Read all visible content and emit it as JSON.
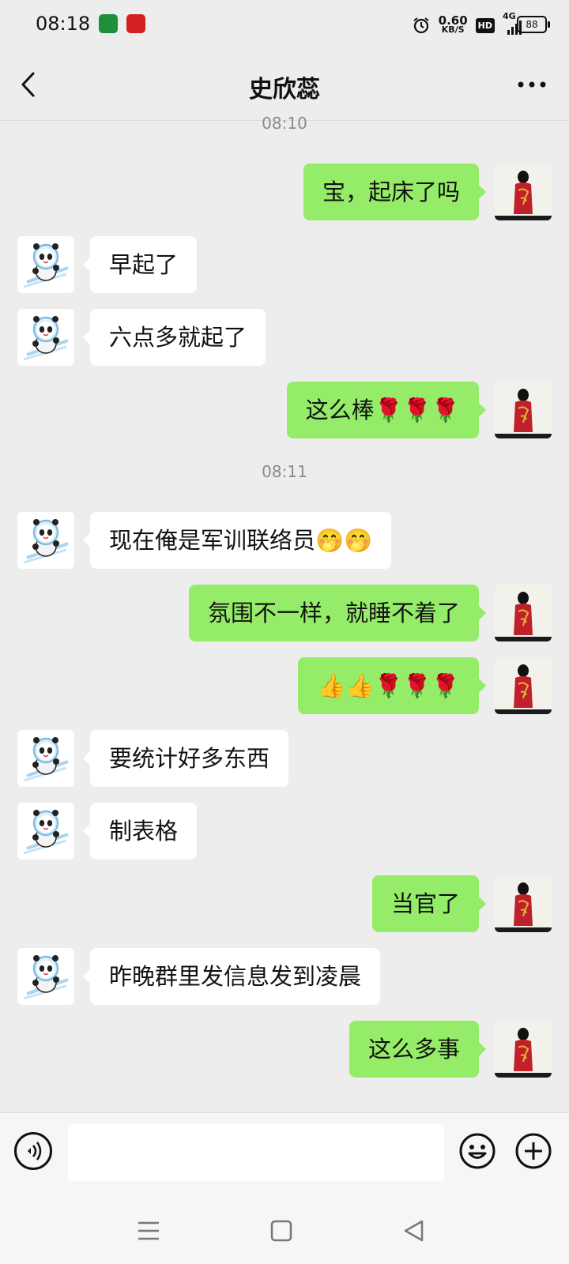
{
  "status_bar": {
    "time": "08:18",
    "net_speed_value": "0.60",
    "net_speed_unit": "KB/S",
    "hd_badge": "HD",
    "network_type": "4G",
    "battery": "88",
    "icons": [
      "app-badge-icon",
      "app-badge-icon",
      "alarm-icon",
      "signal-icon",
      "battery-icon"
    ]
  },
  "header": {
    "title": "史欣蕊",
    "back_icon": "back-icon",
    "more_icon": "more-icon"
  },
  "messages": [
    {
      "type": "timestamp",
      "text": "08:10"
    },
    {
      "type": "msg",
      "side": "right",
      "text": "宝，起床了吗"
    },
    {
      "type": "msg",
      "side": "left",
      "text": "早起了"
    },
    {
      "type": "msg",
      "side": "left",
      "text": "六点多就起了"
    },
    {
      "type": "msg",
      "side": "right",
      "text": "这么棒🌹🌹🌹"
    },
    {
      "type": "timestamp",
      "text": "08:11"
    },
    {
      "type": "msg",
      "side": "left",
      "text": "现在俺是军训联络员🤭🤭"
    },
    {
      "type": "msg",
      "side": "right",
      "text": "氛围不一样，就睡不着了"
    },
    {
      "type": "msg",
      "side": "right",
      "text": "👍👍🌹🌹🌹"
    },
    {
      "type": "msg",
      "side": "left",
      "text": "要统计好多东西"
    },
    {
      "type": "msg",
      "side": "left",
      "text": "制表格"
    },
    {
      "type": "msg",
      "side": "right",
      "text": "当官了"
    },
    {
      "type": "msg",
      "side": "left",
      "text": "昨晚群里发信息发到凌晨"
    },
    {
      "type": "msg",
      "side": "right",
      "text": "这么多事"
    }
  ],
  "input_bar": {
    "value": "",
    "icons": [
      "voice-icon",
      "emoji-icon",
      "plus-icon"
    ]
  },
  "nav_bar": {
    "icons": [
      "menu-icon",
      "home-icon",
      "back-triangle-icon"
    ]
  },
  "colors": {
    "background": "#ededed",
    "own_bubble": "#95ec69",
    "other_bubble": "#ffffff",
    "timestamp": "#8a8a8a"
  }
}
